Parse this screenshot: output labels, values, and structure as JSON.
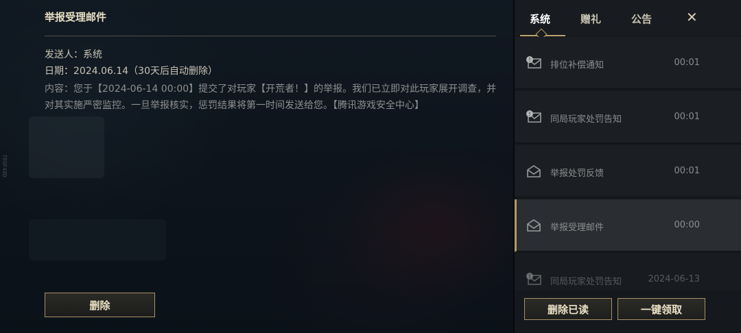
{
  "mail": {
    "title": "举报受理邮件",
    "sender": "发送人：系统",
    "date": "日期：2024.06.14（30天后自动删除）",
    "content": "内容：您于【2024-06-14 00:00】提交了对玩家【开荒者！】的举报。我们已立即对此玩家展开调查，并对其实施严密监控。一旦举报核实，惩罚结果将第一时间发送给您。【腾讯游戏安全中心】",
    "delete_label": "删除"
  },
  "side_mark": "789F48D",
  "tabs": [
    {
      "label": "系统"
    },
    {
      "label": "赠礼"
    },
    {
      "label": "公告"
    }
  ],
  "close_label": "✕",
  "list": [
    {
      "label": "排位补偿通知",
      "time": "00:01",
      "icon": "mail-badge-icon"
    },
    {
      "label": "同局玩家处罚告知",
      "time": "00:01",
      "icon": "mail-badge-icon"
    },
    {
      "label": "举报处罚反馈",
      "time": "00:01",
      "icon": "mail-open-icon"
    },
    {
      "label": "举报受理邮件",
      "time": "00:00",
      "icon": "mail-open-icon"
    },
    {
      "label": "同局玩家处罚告知",
      "time": "2024-06-13",
      "icon": "mail-badge-icon"
    }
  ],
  "actions": {
    "delete_read": "删除已读",
    "claim_all": "一键领取"
  },
  "colors": {
    "accent_gold": "#bda36c",
    "panel_bg": "#16191d",
    "text_muted": "#8d8e8f"
  }
}
